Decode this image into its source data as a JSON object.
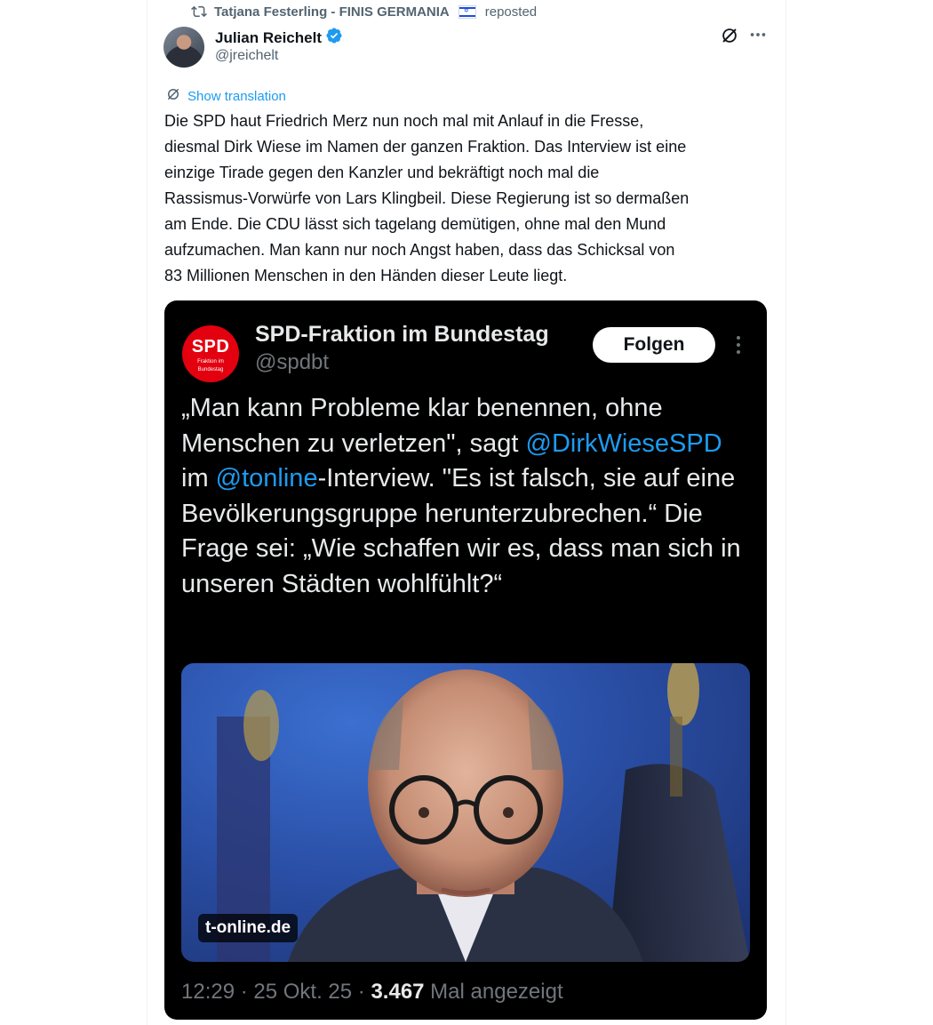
{
  "repost": {
    "user": "Tatjana Festerling - FINIS GERMANIA",
    "flag_icon": "israel-flag-icon",
    "action": "reposted"
  },
  "post": {
    "author_name": "Julian Reichelt",
    "author_handle": "@jreichelt",
    "verified_color": "#1d9bf0",
    "show_translation": "Show translation",
    "text": "Die SPD haut Friedrich Merz nun noch mal mit Anlauf in die Fresse,\ndiesmal Dirk Wiese im Namen der ganzen Fraktion. Das Interview ist eine\neinzige Tirade gegen den Kanzler und bekräftigt noch mal die\nRassismus-Vorwürfe von Lars Klingbeil. Diese Regierung ist so dermaßen\nam Ende. Die CDU lässt sich tagelang demütigen, ohne mal den Mund\naufzumachen. Man kann nur noch Angst haben, dass das Schicksal von\n83 Millionen Menschen in den Händen dieser Leute liegt."
  },
  "embedded": {
    "logo_big": "SPD",
    "logo_small_1": "Fraktion im",
    "logo_small_2": "Bundestag",
    "name": "SPD-Fraktion im Bundestag",
    "handle": "@spdbt",
    "follow_label": "Folgen",
    "quote_part1": "„Man kann Probleme klar benennen, ohne Menschen zu verletzen\", sagt ",
    "mention1": "@DirkWieseSPD",
    "quote_part2": " im ",
    "mention2": "@tonline",
    "quote_part3": "-Interview. \"Es ist falsch, sie auf eine Bevölkerungsgruppe herunterzubrechen.“ Die Frage sei: „Wie schaffen wir es, dass man sich in unseren Städten wohlfühlt?“",
    "source_badge": "t-online.de",
    "time": "12:29 · 25 Okt. 25 · ",
    "views": "3.467",
    "views_suffix": " Mal angezeigt"
  },
  "colors": {
    "link": "#1d9bf0",
    "spd_red": "#e3000f",
    "muted": "#536471"
  }
}
